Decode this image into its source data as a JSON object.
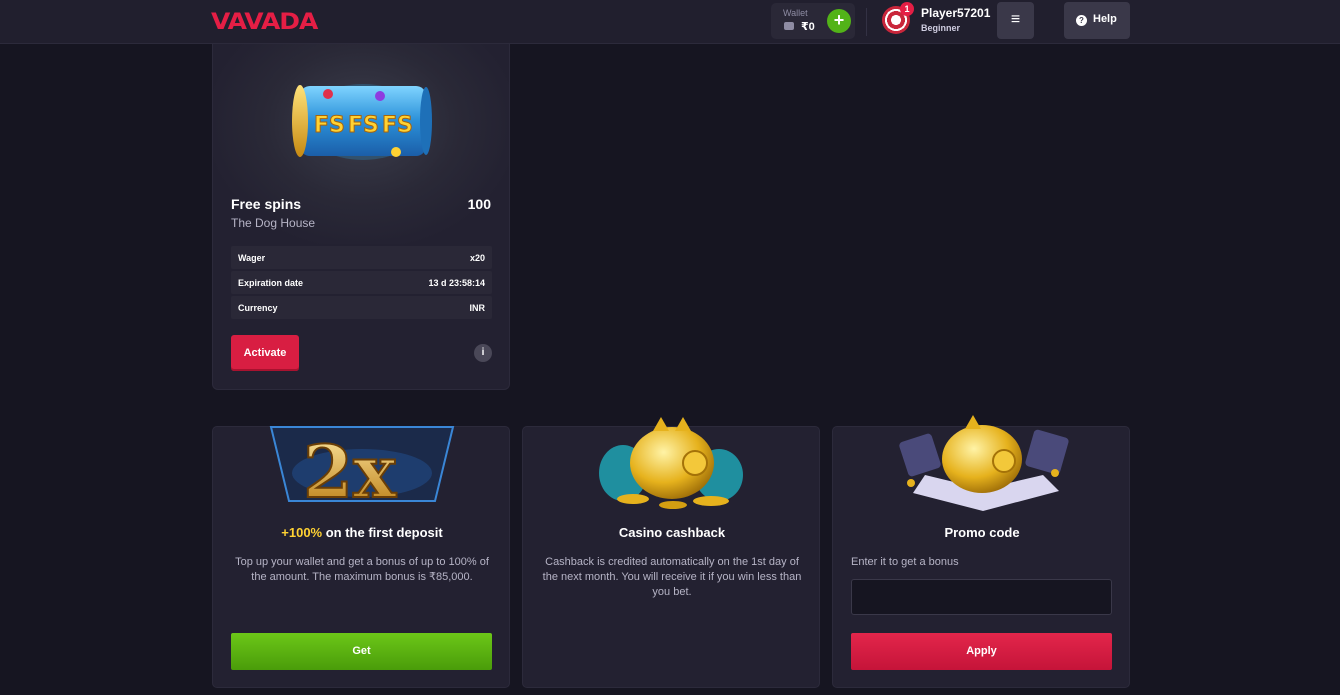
{
  "header": {
    "logo": "VAVADA",
    "wallet_label": "Wallet",
    "wallet_balance": "₹0",
    "add_symbol": "+",
    "notification_count": "1",
    "username": "Player57201",
    "user_level": "Beginner",
    "menu_symbol": "≡",
    "help_label": "Help"
  },
  "free_spins": {
    "title": "Free spins",
    "game": "The Dog House",
    "count": "100",
    "rows": [
      {
        "label": "Wager",
        "value": "x20"
      },
      {
        "label": "Expiration date",
        "value": "13 d 23:58:14"
      },
      {
        "label": "Currency",
        "value": "INR"
      }
    ],
    "activate_label": "Activate",
    "info_symbol": "i",
    "art_text": "FS"
  },
  "deposit": {
    "art_text": "2x",
    "title_highlight": "+100%",
    "title_rest": " on the first deposit",
    "description": "Top up your wallet and get a bonus of up to 100% of the amount. The maximum bonus is ₹85,000.",
    "button_label": "Get"
  },
  "cashback": {
    "title": "Casino cashback",
    "description": "Cashback is credited automatically on the 1st day of the next month. You will receive it if you win less than you bet."
  },
  "promo": {
    "title": "Promo code",
    "description": "Enter it to get a bonus",
    "input_value": "",
    "button_label": "Apply"
  },
  "colors": {
    "background": "#161521",
    "card": "#232131",
    "accent_red": "#e51e45",
    "accent_green": "#52b318",
    "highlight_yellow": "#ffd233"
  }
}
